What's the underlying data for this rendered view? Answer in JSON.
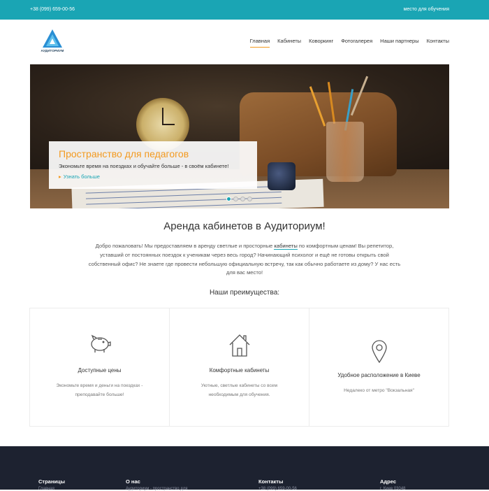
{
  "topbar": {
    "phone": "+38 (099) 659-00-56",
    "tagline": "место для обучения"
  },
  "header": {
    "logo_text": "АУДИТОРИУМ",
    "nav": [
      {
        "label": "Главная",
        "active": true
      },
      {
        "label": "Кабинеты"
      },
      {
        "label": "Коворкинг"
      },
      {
        "label": "Фотогалерея"
      },
      {
        "label": "Наши партнеры"
      },
      {
        "label": "Контакты"
      }
    ]
  },
  "hero": {
    "title": "Пространство для педагогов",
    "text": "Экономьте время на поездках и обучайте больше - в своём кабинете!",
    "link": "Узнать больше",
    "slides_count": 4,
    "active_slide": 1
  },
  "main": {
    "title": "Аренда кабинетов в Аудиториум!",
    "intro_before": "Добро пожаловать! Мы предоставляем в аренду светлые и просторные ",
    "intro_link": "кабинеты",
    "intro_after": " по комфортным ценам! Вы репетитор, уставший от постоянных поездок к ученикам через весь город? Начинающий психолог и ещё не готовы открыть свой собственный офис? Не знаете где провести небольшую официальную встречу, так как обычно работаете из дому? У нас есть для вас место!",
    "advantages_title": "Наши преимущества:",
    "cards": [
      {
        "icon": "piggy-bank-icon",
        "title": "Доступные цены",
        "desc": "Экономьте время и деньги на поездках - преподавайте больше!"
      },
      {
        "icon": "house-icon",
        "title": "Комфортные кабинеты",
        "desc": "Уютные, светлые кабинеты со всем необходимым для обучения."
      },
      {
        "icon": "map-pin-icon",
        "title": "Удобное расположение в Киеве",
        "desc": "Недалеко от метро \"Вокзальная\""
      }
    ]
  },
  "footer": {
    "columns": [
      {
        "title": "Страницы",
        "sub": "Главная"
      },
      {
        "title": "О нас",
        "sub": "Аудиториум - пространство для"
      },
      {
        "title": "Контакты",
        "sub": "+38 (099) 659-00-56"
      },
      {
        "title": "Адрес",
        "sub": "г. Киев 03048"
      }
    ]
  },
  "colors": {
    "accent": "#1aa5b4",
    "orange": "#f39a20",
    "footer_bg": "#1d2230"
  }
}
